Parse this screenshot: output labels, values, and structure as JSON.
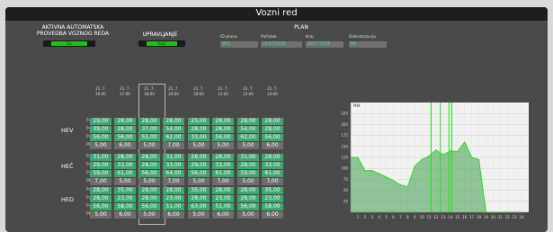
{
  "window": {
    "title": "Vozni red"
  },
  "controls": {
    "auto_label": "AKTIVNA AUTOMATSKA PROVEDBA VOZNOG REDA",
    "auto_state": "Da",
    "manage_label": "UPRAVLJANJE",
    "manage_state": "Auto"
  },
  "plan": {
    "title": "PLAN",
    "fields": [
      {
        "label": "ID plana",
        "value": "962"
      },
      {
        "label": "Početak",
        "value": "21072025"
      },
      {
        "label": "Kraj",
        "value": "22072025"
      },
      {
        "label": "Diskretizacija",
        "value": "60"
      }
    ]
  },
  "schedule": {
    "dates": [
      {
        "date": "21. 7.",
        "time": "16:00"
      },
      {
        "date": "21. 7.",
        "time": "17:00"
      },
      {
        "date": "21. 7.",
        "time": "18:00"
      },
      {
        "date": "21. 7.",
        "time": "19:00"
      },
      {
        "date": "21. 7.",
        "time": "20:00"
      },
      {
        "date": "21. 7.",
        "time": "21:00"
      },
      {
        "date": "21. 7.",
        "time": "22:00"
      },
      {
        "date": "21. 7.",
        "time": "23:00"
      }
    ],
    "groups": [
      {
        "name": "HEV",
        "rows": [
          {
            "label": "P₍MIN₎",
            "values": [
              "29,00",
              "28,00",
              "28,00",
              "28,00",
              "25,00",
              "28,00",
              "28,00",
              "28,00"
            ]
          },
          {
            "label": "P₍MAX₎",
            "values": [
              "39,00",
              "28,00",
              "37,00",
              "54,00",
              "28,00",
              "28,00",
              "54,00",
              "28,00"
            ]
          },
          {
            "label": "P₍S₎",
            "values": [
              "56,00",
              "56,00",
              "55,00",
              "62,00",
              "33,00",
              "56,00",
              "62,00",
              "56,00"
            ]
          },
          {
            "label": "PRELJEV",
            "values": [
              "5,00",
              "6,00",
              "5,00",
              "7,00",
              "5,00",
              "5,00",
              "5,00",
              "6,00"
            ]
          }
        ]
      },
      {
        "name": "HEČ",
        "rows": [
          {
            "label": "P₍MIN₎",
            "values": [
              "31,00",
              "28,00",
              "28,00",
              "31,00",
              "28,00",
              "28,00",
              "31,00",
              "28,00"
            ]
          },
          {
            "label": "P₍MAX₎",
            "values": [
              "29,00",
              "33,00",
              "28,00",
              "33,00",
              "29,00",
              "33,00",
              "28,00",
              "33,00"
            ]
          },
          {
            "label": "P₍S₎",
            "values": [
              "59,00",
              "61,00",
              "56,00",
              "64,00",
              "56,00",
              "61,00",
              "59,00",
              "61,00"
            ]
          },
          {
            "label": "PRELJEV",
            "values": [
              "7,00",
              "5,00",
              "5,00",
              "7,00",
              "5,00",
              "7,00",
              "5,00",
              "7,00"
            ]
          }
        ]
      },
      {
        "name": "HED",
        "rows": [
          {
            "label": "P₍MIN₎",
            "values": [
              "28,00",
              "35,00",
              "28,00",
              "28,00",
              "35,00",
              "28,00",
              "28,00",
              "35,00"
            ]
          },
          {
            "label": "P₍MAX₎",
            "values": [
              "28,00",
              "23,00",
              "28,00",
              "23,00",
              "28,00",
              "23,00",
              "28,00",
              "23,00"
            ]
          },
          {
            "label": "P₍S₎",
            "values": [
              "56,00",
              "58,00",
              "56,00",
              "51,00",
              "63,00",
              "51,00",
              "56,00",
              "58,00"
            ]
          },
          {
            "label": "PRELJEV",
            "values": [
              "5,00",
              "6,00",
              "5,00",
              "6,00",
              "5,00",
              "6,00",
              "5,00",
              "6,00"
            ]
          }
        ]
      }
    ]
  },
  "chart_data": {
    "type": "area",
    "ylabel": "MW",
    "ylim": [
      0,
      250
    ],
    "yticks": [
      25,
      50,
      75,
      100,
      125,
      150,
      175,
      200,
      225
    ],
    "x": [
      1,
      2,
      3,
      4,
      5,
      6,
      7,
      8,
      9,
      10,
      11,
      12,
      13,
      14,
      15,
      16,
      17,
      18,
      19,
      20,
      21,
      22,
      23,
      24
    ],
    "series": [
      {
        "values": [
          125,
          95,
          95,
          88,
          80,
          72,
          62,
          58,
          105,
          120,
          128,
          142,
          130,
          140,
          138,
          160,
          125,
          120,
          0,
          0,
          0,
          0,
          0,
          0
        ]
      }
    ],
    "spikes": [
      11.3,
      12.6,
      13.8,
      14.2
    ],
    "fill_color": "#3ea04a",
    "line_color": "#20e020"
  }
}
